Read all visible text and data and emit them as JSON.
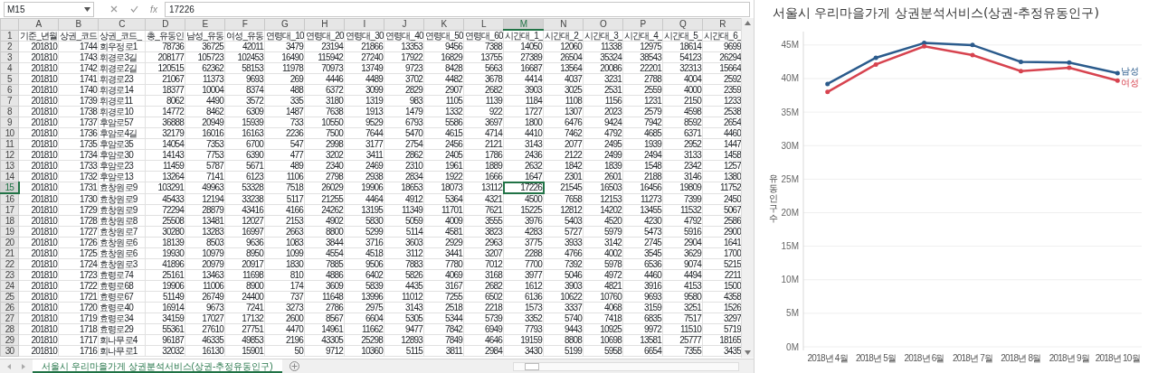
{
  "formula_bar": {
    "name_box": "M15",
    "function_label": "fx",
    "value": "17226"
  },
  "sheet": {
    "columns": [
      {
        "letter": "A",
        "kind": "number",
        "selected": false
      },
      {
        "letter": "B",
        "kind": "number",
        "selected": false
      },
      {
        "letter": "C",
        "kind": "text",
        "selected": false
      },
      {
        "letter": "D",
        "kind": "number",
        "selected": false
      },
      {
        "letter": "E",
        "kind": "number",
        "selected": false
      },
      {
        "letter": "F",
        "kind": "number",
        "selected": false
      },
      {
        "letter": "G",
        "kind": "number",
        "selected": false
      },
      {
        "letter": "H",
        "kind": "number",
        "selected": false
      },
      {
        "letter": "I",
        "kind": "number",
        "selected": false
      },
      {
        "letter": "J",
        "kind": "number",
        "selected": false
      },
      {
        "letter": "K",
        "kind": "number",
        "selected": false
      },
      {
        "letter": "L",
        "kind": "number",
        "selected": false
      },
      {
        "letter": "M",
        "kind": "number",
        "selected": true
      },
      {
        "letter": "N",
        "kind": "number",
        "selected": false
      },
      {
        "letter": "O",
        "kind": "number",
        "selected": false
      },
      {
        "letter": "P",
        "kind": "number",
        "selected": false
      },
      {
        "letter": "Q",
        "kind": "number",
        "selected": false
      },
      {
        "letter": "R",
        "kind": "number",
        "selected": false
      }
    ],
    "rows": [
      {
        "number": "1",
        "selected": false,
        "cells": [
          "기준_년월",
          "상권_코드",
          "상권_코드_",
          "총_유동인",
          "남성_유동",
          "여성_유동",
          "연령대_10",
          "연령대_20",
          "연령대_30",
          "연령대_40",
          "연령대_50",
          "연령대_60",
          "시간대_1_",
          "시간대_2_",
          "시간대_3_",
          "시간대_4_",
          "시간대_5_",
          "시간대_6_"
        ]
      },
      {
        "number": "2",
        "selected": false,
        "cells": [
          "201810",
          "1744",
          "회우정로1",
          "78736",
          "36725",
          "42011",
          "3479",
          "23194",
          "21866",
          "13353",
          "9456",
          "7388",
          "14050",
          "12060",
          "11338",
          "12975",
          "18614",
          "9699"
        ]
      },
      {
        "number": "3",
        "selected": false,
        "cells": [
          "201810",
          "1743",
          "휘경로3길",
          "208177",
          "105723",
          "102453",
          "16490",
          "115942",
          "27240",
          "17922",
          "16829",
          "13755",
          "27389",
          "26504",
          "35324",
          "38543",
          "54123",
          "26294"
        ]
      },
      {
        "number": "4",
        "selected": false,
        "cells": [
          "201810",
          "1742",
          "휘경로2길",
          "120515",
          "62362",
          "58153",
          "11978",
          "70973",
          "13749",
          "9723",
          "8428",
          "5663",
          "16687",
          "13564",
          "20086",
          "22201",
          "32313",
          "15664"
        ]
      },
      {
        "number": "5",
        "selected": false,
        "cells": [
          "201810",
          "1741",
          "휘경로23",
          "21067",
          "11373",
          "9693",
          "269",
          "4446",
          "4489",
          "3702",
          "4482",
          "3678",
          "4414",
          "4037",
          "3231",
          "2788",
          "4004",
          "2592"
        ]
      },
      {
        "number": "6",
        "selected": false,
        "cells": [
          "201810",
          "1740",
          "휘경로14",
          "18377",
          "10004",
          "8374",
          "488",
          "6372",
          "3099",
          "2829",
          "2907",
          "2682",
          "3903",
          "3025",
          "2531",
          "2559",
          "4000",
          "2359"
        ]
      },
      {
        "number": "7",
        "selected": false,
        "cells": [
          "201810",
          "1739",
          "휘경로11",
          "8062",
          "4490",
          "3572",
          "335",
          "3180",
          "1319",
          "983",
          "1105",
          "1139",
          "1184",
          "1108",
          "1156",
          "1231",
          "2150",
          "1233"
        ]
      },
      {
        "number": "8",
        "selected": false,
        "cells": [
          "201810",
          "1738",
          "휘경로10",
          "14772",
          "8462",
          "6309",
          "1487",
          "7638",
          "1913",
          "1479",
          "1332",
          "922",
          "1727",
          "1307",
          "2023",
          "2579",
          "4598",
          "2538"
        ]
      },
      {
        "number": "9",
        "selected": false,
        "cells": [
          "201810",
          "1737",
          "후암로57",
          "36888",
          "20949",
          "15939",
          "733",
          "10550",
          "9529",
          "6793",
          "5586",
          "3697",
          "1800",
          "6476",
          "9424",
          "7942",
          "8592",
          "2654"
        ]
      },
      {
        "number": "10",
        "selected": false,
        "cells": [
          "201810",
          "1736",
          "후암로4길",
          "32179",
          "16016",
          "16163",
          "2236",
          "7500",
          "7644",
          "5470",
          "4615",
          "4714",
          "4410",
          "7462",
          "4792",
          "4685",
          "6371",
          "4460"
        ]
      },
      {
        "number": "11",
        "selected": false,
        "cells": [
          "201810",
          "1735",
          "후암로35",
          "14054",
          "7353",
          "6700",
          "547",
          "2998",
          "3177",
          "2754",
          "2456",
          "2121",
          "3143",
          "2077",
          "2495",
          "1939",
          "2952",
          "1447"
        ]
      },
      {
        "number": "12",
        "selected": false,
        "cells": [
          "201810",
          "1734",
          "후암로30",
          "14143",
          "7753",
          "6390",
          "477",
          "3202",
          "3411",
          "2862",
          "2405",
          "1786",
          "2436",
          "2122",
          "2499",
          "2494",
          "3133",
          "1458"
        ]
      },
      {
        "number": "13",
        "selected": false,
        "cells": [
          "201810",
          "1733",
          "후암로23",
          "11459",
          "5787",
          "5671",
          "489",
          "2340",
          "2469",
          "2310",
          "1961",
          "1889",
          "2632",
          "1842",
          "1839",
          "1548",
          "2342",
          "1257"
        ]
      },
      {
        "number": "14",
        "selected": false,
        "cells": [
          "201810",
          "1732",
          "후암로13",
          "13264",
          "7141",
          "6123",
          "1106",
          "2798",
          "2938",
          "2834",
          "1922",
          "1666",
          "1647",
          "2301",
          "2601",
          "2188",
          "3146",
          "1380"
        ]
      },
      {
        "number": "15",
        "selected": true,
        "cells": [
          "201810",
          "1731",
          "효창원로9",
          "103291",
          "49963",
          "53328",
          "7518",
          "26029",
          "19906",
          "18653",
          "18073",
          "13112",
          "17226",
          "21545",
          "16503",
          "16456",
          "19809",
          "11752"
        ]
      },
      {
        "number": "16",
        "selected": false,
        "cells": [
          "201810",
          "1730",
          "효창원로9",
          "45433",
          "12194",
          "33238",
          "5117",
          "21255",
          "4464",
          "4912",
          "5364",
          "4321",
          "4500",
          "7658",
          "12153",
          "11273",
          "7399",
          "2450"
        ]
      },
      {
        "number": "17",
        "selected": false,
        "cells": [
          "201810",
          "1729",
          "효창원로9",
          "72294",
          "28879",
          "43416",
          "4166",
          "24262",
          "13195",
          "11349",
          "11701",
          "7621",
          "15225",
          "12812",
          "14202",
          "13455",
          "11532",
          "5067"
        ]
      },
      {
        "number": "18",
        "selected": false,
        "cells": [
          "201810",
          "1728",
          "효창원로8",
          "25508",
          "13481",
          "12027",
          "2153",
          "4902",
          "5830",
          "5059",
          "4009",
          "3555",
          "3976",
          "5403",
          "4520",
          "4230",
          "4792",
          "2586"
        ]
      },
      {
        "number": "19",
        "selected": false,
        "cells": [
          "201810",
          "1727",
          "효창원로7",
          "30280",
          "13283",
          "16997",
          "2663",
          "8800",
          "5299",
          "5114",
          "4581",
          "3823",
          "4283",
          "5727",
          "5979",
          "5473",
          "5916",
          "2900"
        ]
      },
      {
        "number": "20",
        "selected": false,
        "cells": [
          "201810",
          "1726",
          "효창원로6",
          "18139",
          "8503",
          "9636",
          "1083",
          "3844",
          "3716",
          "3603",
          "2929",
          "2963",
          "3775",
          "3933",
          "3142",
          "2745",
          "2904",
          "1641"
        ]
      },
      {
        "number": "21",
        "selected": false,
        "cells": [
          "201810",
          "1725",
          "효창원로6",
          "19930",
          "10979",
          "8950",
          "1099",
          "4554",
          "4518",
          "3112",
          "3441",
          "3207",
          "2288",
          "4766",
          "4002",
          "3545",
          "3629",
          "1700"
        ]
      },
      {
        "number": "22",
        "selected": false,
        "cells": [
          "201810",
          "1724",
          "효창원로3",
          "41896",
          "20979",
          "20917",
          "1830",
          "7885",
          "9506",
          "7883",
          "7780",
          "7012",
          "7700",
          "7392",
          "5978",
          "6536",
          "9074",
          "5215"
        ]
      },
      {
        "number": "23",
        "selected": false,
        "cells": [
          "201810",
          "1723",
          "효령로74",
          "25161",
          "13463",
          "11698",
          "810",
          "4886",
          "6402",
          "5826",
          "4069",
          "3168",
          "3977",
          "5046",
          "4972",
          "4460",
          "4494",
          "2211"
        ]
      },
      {
        "number": "24",
        "selected": false,
        "cells": [
          "201810",
          "1722",
          "효령로68",
          "19906",
          "11006",
          "8900",
          "174",
          "3609",
          "5839",
          "4435",
          "3167",
          "2682",
          "1612",
          "3903",
          "4821",
          "3916",
          "4153",
          "1500"
        ]
      },
      {
        "number": "25",
        "selected": false,
        "cells": [
          "201810",
          "1721",
          "효령로67",
          "51149",
          "26749",
          "24400",
          "737",
          "11648",
          "13996",
          "11012",
          "7255",
          "6502",
          "6136",
          "10622",
          "10760",
          "9693",
          "9580",
          "4358"
        ]
      },
      {
        "number": "26",
        "selected": false,
        "cells": [
          "201810",
          "1720",
          "효령로40",
          "16914",
          "9673",
          "7241",
          "3273",
          "2786",
          "2975",
          "3143",
          "2518",
          "2218",
          "1573",
          "3337",
          "4068",
          "3159",
          "3251",
          "1526"
        ]
      },
      {
        "number": "27",
        "selected": false,
        "cells": [
          "201810",
          "1719",
          "효령로34",
          "34159",
          "17027",
          "17132",
          "2600",
          "8567",
          "6604",
          "5305",
          "5344",
          "5739",
          "3352",
          "5740",
          "7418",
          "6835",
          "7517",
          "3297"
        ]
      },
      {
        "number": "28",
        "selected": false,
        "cells": [
          "201810",
          "1718",
          "효령로29",
          "55361",
          "27610",
          "27751",
          "4470",
          "14961",
          "11662",
          "9477",
          "7842",
          "6949",
          "7793",
          "9443",
          "10925",
          "9972",
          "11510",
          "5719"
        ]
      },
      {
        "number": "29",
        "selected": false,
        "cells": [
          "201810",
          "1717",
          "회나무로4",
          "96187",
          "46335",
          "49853",
          "2196",
          "43305",
          "25298",
          "12893",
          "7849",
          "4646",
          "19159",
          "8808",
          "10698",
          "13581",
          "25777",
          "18165"
        ]
      },
      {
        "number": "30",
        "selected": false,
        "cells": [
          "201810",
          "1716",
          "회나무로1",
          "32032",
          "16130",
          "15901",
          "50",
          "9712",
          "10360",
          "5115",
          "3811",
          "2984",
          "3430",
          "5199",
          "5958",
          "6654",
          "7355",
          "3435"
        ]
      }
    ]
  },
  "sheet_tabs": [
    {
      "label": "서울시 우리마을가게 상권분석서비스(상권-추정유동인구)",
      "selected": true
    }
  ],
  "chart": {
    "title": "서울시 우리마을가게 상권분석서비스(상권-추정유동인구)",
    "chart_data": {
      "type": "line",
      "ylabel": "유동인구수",
      "categories": [
        "2018년 4월",
        "2018년 5월",
        "2018년 6월",
        "2018년 7월",
        "2018년 8월",
        "2018년 9월",
        "2018년 10월"
      ],
      "series": [
        {
          "name": "남성",
          "color": "#2b5b8c",
          "values": [
            39200000,
            43100000,
            45300000,
            45000000,
            42500000,
            42400000,
            40800000
          ]
        },
        {
          "name": "여성",
          "color": "#d7434f",
          "values": [
            38000000,
            42100000,
            44800000,
            43500000,
            41100000,
            41600000,
            39700000
          ]
        }
      ],
      "ylim": [
        0,
        47000000
      ],
      "grid": true,
      "yticks": [
        {
          "value": 0,
          "label": "0M"
        },
        {
          "value": 5000000,
          "label": "5M"
        },
        {
          "value": 10000000,
          "label": "10M"
        },
        {
          "value": 15000000,
          "label": "15M"
        },
        {
          "value": 20000000,
          "label": "20M"
        },
        {
          "value": 25000000,
          "label": "25M"
        },
        {
          "value": 30000000,
          "label": "30M"
        },
        {
          "value": 35000000,
          "label": "35M"
        },
        {
          "value": 40000000,
          "label": "40M"
        },
        {
          "value": 45000000,
          "label": "45M"
        }
      ]
    }
  }
}
